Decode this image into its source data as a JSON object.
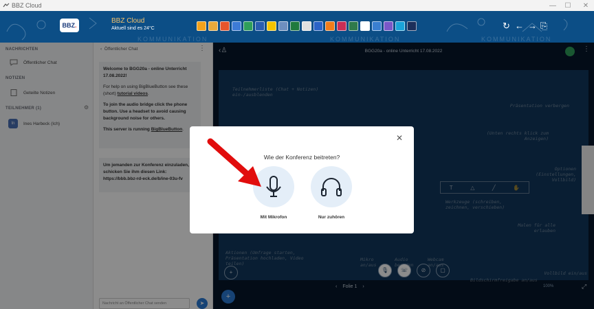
{
  "window": {
    "title": "BBZ Cloud"
  },
  "header": {
    "logo_text": "BBZ",
    "title": "BBZ Cloud",
    "subtitle": "Aktuell sind es 24°C"
  },
  "sidebar": {
    "messages_heading": "NACHRICHTEN",
    "public_chat": "Öffentlicher Chat",
    "notes_heading": "NOTIZEN",
    "shared_notes": "Geteilte Notizen",
    "participants_heading": "TEILNEHMER (1)",
    "participant_initials": "In",
    "participant_name": "Ines Harbeck (Ich)"
  },
  "chat": {
    "header": "Öffentlicher Chat",
    "welcome_title": "Welcome to BGG20a - online Unterricht 17.08.2022!",
    "help_text": "For help on using BigBlueButton see these (short)",
    "help_link": "tutorial videos",
    "audio_text": "To join the audio bridge click the phone button. Use a headset to avoid causing background noise for others.",
    "server_text": "This server is running",
    "server_link": "BigBlueButton",
    "invite_text": "Um jemanden zur Konferenz einzuladen, schicken Sie ihm diesen Link:",
    "invite_link": "https://bbb.bbz-rd-eck.de/b/ine-03u-fv",
    "input_placeholder": "Nachricht an Öffentlicher Chat senden"
  },
  "presentation": {
    "title": "BGG20a - online Unterricht 17.08.2022",
    "slide_label": "Folie 1",
    "zoom": "100%",
    "notes": {
      "users": "Teilnehmerliste (Chat + Notizen) ein-/ausblenden",
      "hide": "Präsentation verbergen",
      "hide_sub": "(Unten rechts klick zum Anzeigen)",
      "options": "Optionen (Einstellungen, Vollbild)",
      "tools": "Werkzeuge (schreiben, zeichnen, verschieben)",
      "paint": "Malen für alle erlauben",
      "actions": "Aktionen (Umfrage starten, Präsentation hochladen, Video teilen)",
      "mic": "Mikro an/aus",
      "audio": "Audio beenden",
      "webcam": "Webcam an/aus",
      "screenshare": "Bildschirmfreigabe an/aus",
      "fullscreen": "Vollbild ein/aus"
    }
  },
  "modal": {
    "title": "Wie der Konferenz beitreten?",
    "mic_label": "Mit Mikrofon",
    "listen_label": "Nur zuhören"
  },
  "colors": {
    "header_bg": "#0c4e86",
    "accent": "#2a7bd5",
    "arrow": "#e10d0d"
  }
}
